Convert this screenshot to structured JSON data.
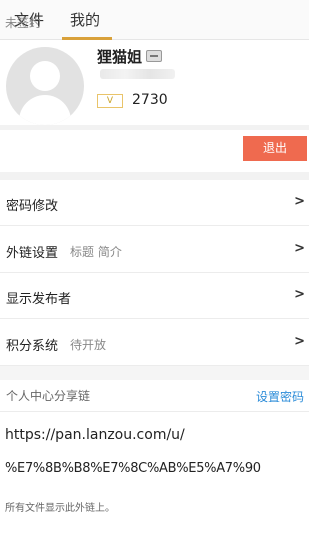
{
  "tabs": {
    "files": "文件",
    "mine": "我的"
  },
  "profile": {
    "username": "狸猫姐",
    "vip_badge": "V",
    "score": "2730"
  },
  "sign": {
    "status": "未签约",
    "logout": "退出"
  },
  "menu": {
    "password": {
      "label": "密码修改",
      "chevron": ">"
    },
    "external_link": {
      "label": "外链设置",
      "sub": "标题 简介",
      "chevron": ">"
    },
    "show_publisher": {
      "label": "显示发布者",
      "chevron": ">"
    },
    "points": {
      "label": "积分系统",
      "sub": "待开放",
      "chevron": ">"
    }
  },
  "share": {
    "header": "个人中心分享链",
    "set_password": "设置密码",
    "link_line1": "https://pan.lanzou.com/u/",
    "link_line2": "%E7%8B%B8%E7%8C%AB%E5%A7%90",
    "note": "所有文件显示此外链上。"
  },
  "colors": {
    "accent": "#d9a13a",
    "logout_bg": "#ef6a4f",
    "link": "#2a8bd8"
  },
  "icons": {
    "avatar": "default-avatar-icon",
    "card": "id-card-icon",
    "chevron": "chevron-right-icon"
  }
}
